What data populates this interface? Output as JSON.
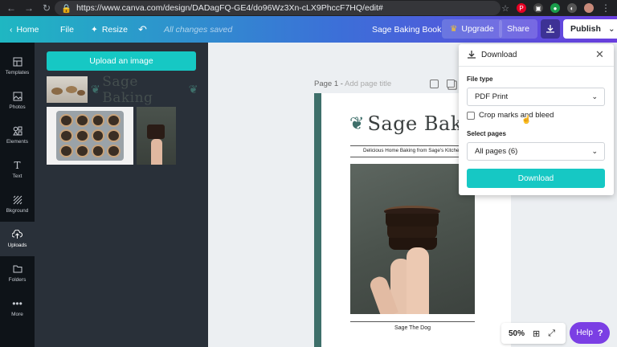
{
  "browser": {
    "url": "https://www.canva.com/design/DADagFQ-GE4/do96Wz3Xn-cLX9PhccF7HQ/edit#"
  },
  "topbar": {
    "home": "Home",
    "file": "File",
    "resize": "Resize",
    "status": "All changes saved",
    "design_title": "Sage Baking Book",
    "upgrade": "Upgrade",
    "share": "Share",
    "publish": "Publish"
  },
  "rail": [
    {
      "label": "Templates",
      "icon": "templates-icon"
    },
    {
      "label": "Photos",
      "icon": "photos-icon"
    },
    {
      "label": "Elements",
      "icon": "elements-icon"
    },
    {
      "label": "Text",
      "icon": "text-icon"
    },
    {
      "label": "Bkground",
      "icon": "background-icon"
    },
    {
      "label": "Uploads",
      "icon": "uploads-icon"
    },
    {
      "label": "Folders",
      "icon": "folders-icon"
    },
    {
      "label": "More",
      "icon": "more-icon"
    }
  ],
  "uploads": {
    "button": "Upload an image"
  },
  "page": {
    "label": "Page 1",
    "add_title": "Add page title"
  },
  "document": {
    "title": "Sage Baking",
    "subtitle": "Delicious Home Baking from Sage's Kitchen",
    "caption": "Sage The Dog"
  },
  "download": {
    "title": "Download",
    "file_type_label": "File type",
    "file_type_value": "PDF Print",
    "crop_label": "Crop marks and bleed",
    "select_pages_label": "Select pages",
    "pages_value": "All pages (6)",
    "button": "Download"
  },
  "zoom": {
    "value": "50%"
  },
  "help": {
    "label": "Help",
    "icon": "?"
  },
  "colors": {
    "accent": "#16c8c4",
    "purple": "#7b3fe4",
    "stripe": "#3e6f6a"
  }
}
